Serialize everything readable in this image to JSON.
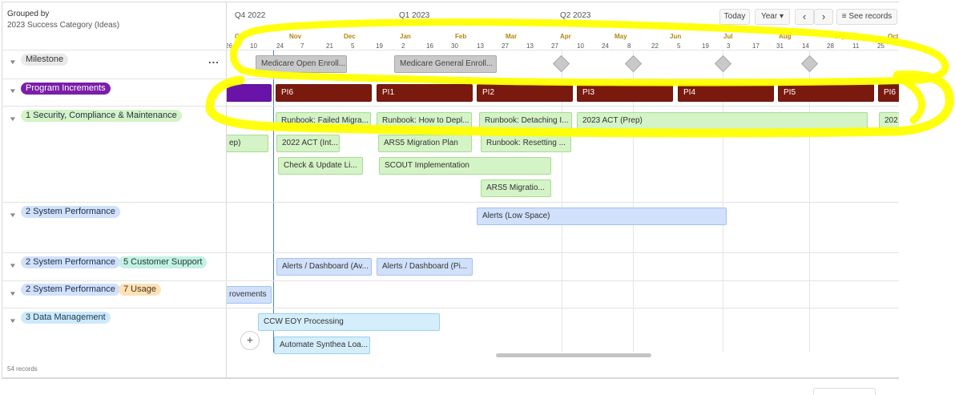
{
  "sidebar": {
    "group_title": "Grouped by",
    "group_subtitle": "2023 Success Category (Ideas)",
    "records": "54 records",
    "more": "...",
    "rows": {
      "milestone": "Milestone",
      "program_increments": "Program Increments",
      "security": "1 Security, Compliance & Maintenance",
      "sys_perf": "2 System Performance",
      "sys_perf_b": "2 System Performance",
      "customer_support": "5 Customer Support",
      "sys_perf_c": "2 System Performance",
      "usage": "7 Usage",
      "data_mgmt": "3 Data Management"
    }
  },
  "timeline_header": {
    "quarters": [
      "Q4 2022",
      "Q1 2023",
      "Q2 2023"
    ],
    "months": [
      "Oct",
      "Nov",
      "Dec",
      "Jan",
      "Feb",
      "Mar",
      "Apr",
      "May",
      "Jun",
      "Jul",
      "Aug",
      "Sep",
      "Oct"
    ],
    "days": [
      "26",
      "10",
      "24",
      "7",
      "21",
      "5",
      "19",
      "2",
      "16",
      "30",
      "13",
      "27",
      "13",
      "27",
      "10",
      "24",
      "8",
      "22",
      "5",
      "19",
      "3",
      "17",
      "31",
      "14",
      "28",
      "11",
      "25"
    ],
    "today_label": "Today",
    "scale_label": "Year",
    "prev_icon": "chevron-left-icon",
    "next_icon": "chevron-right-icon",
    "see_records_label": "See records"
  },
  "bars": {
    "milestones": [
      "Medicare Open Enroll...",
      "Medicare General Enroll..."
    ],
    "program_increments": [
      "PI6",
      "PI1",
      "PI2",
      "PI3",
      "PI4",
      "PI5",
      "PI6"
    ],
    "security": [
      "Runbook: Failed Migra...",
      "Runbook: How to Depl...",
      "Runbook: Detaching I...",
      "2023 ACT (Prep)",
      "202",
      "ep)",
      "2022 ACT (Int...",
      "ARS5 Migration Plan",
      "Runbook: Resetting ...",
      "Check & Update Li...",
      "SCOUT Implementation",
      "ARS5 Migratio..."
    ],
    "sys_perf": [
      "Alerts (Low Space)"
    ],
    "sys_perf_cs": [
      "Alerts / Dashboard (Av...",
      "Alerts / Dashboard (Pi..."
    ],
    "sys_perf_usage": [
      "rovements"
    ],
    "data_mgmt": [
      "CCW EOY Processing",
      "Automate Synthea Loa..."
    ]
  },
  "add_label": "+",
  "colors": {
    "program_increment": "#6a13a8",
    "pi_bar": "#7a1a0f",
    "highlight": "#ffff00",
    "today_line": "#4a7fd0"
  }
}
